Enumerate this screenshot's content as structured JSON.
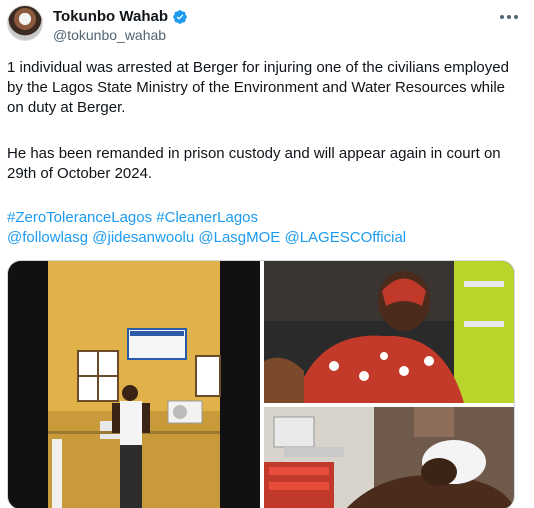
{
  "author": {
    "name": "Tokunbo Wahab",
    "handle": "@tokunbo_wahab",
    "verified": true
  },
  "tweet": {
    "paragraph1": "1 individual was arrested at Berger for injuring one of the civilians employed by the Lagos State Ministry of the Environment and Water Resources  while on duty at Berger.",
    "paragraph2": "He has been remanded in prison custody and will appear again in court on 29th of October 2024.",
    "hashtags": [
      "#ZeroToleranceLagos",
      "#CleanerLagos"
    ],
    "mentions": [
      "@followlasg",
      "@jidesanwoolu",
      "@LasgMOE",
      "@LAGESCOfficial"
    ]
  },
  "icons": {
    "verified": "verified-badge-icon",
    "more": "more-options-icon"
  },
  "colors": {
    "link": "#1d9bf0",
    "text": "#0f1419",
    "secondary": "#536471"
  }
}
